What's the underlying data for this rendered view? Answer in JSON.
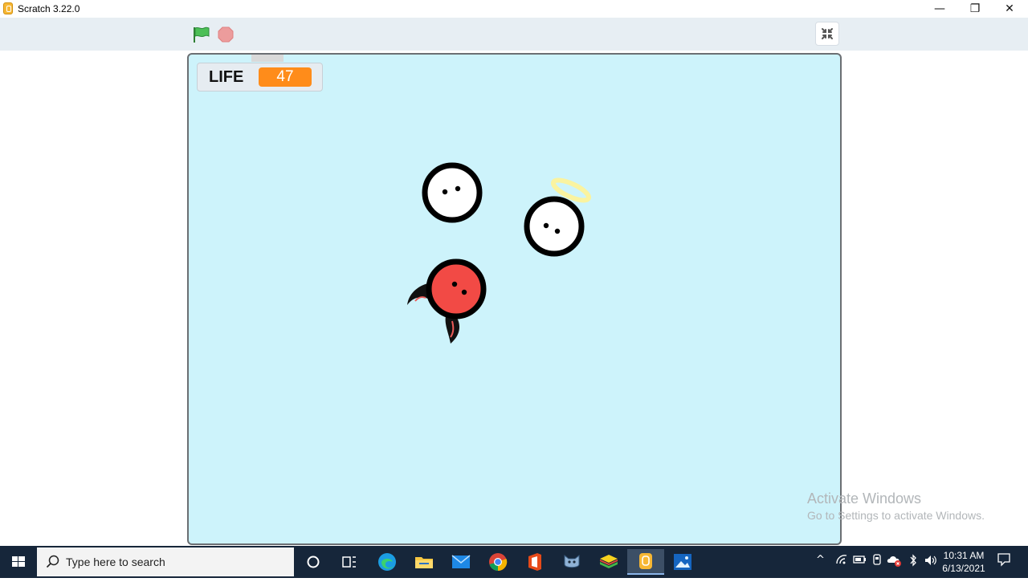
{
  "window": {
    "title": "Scratch 3.22.0",
    "minimize_glyph": "—",
    "restore_glyph": "❐",
    "close_glyph": "✕"
  },
  "toolbar": {
    "green_flag_icon": "green-flag-icon",
    "stop_icon": "stop-sign-icon",
    "unfullscreen_icon": "exit-fullscreen-icon"
  },
  "stage": {
    "background_color": "#cdf3fb",
    "monitor": {
      "label": "LIFE",
      "value": "47"
    },
    "sprites": [
      "white-ball-character",
      "angel-ball-character",
      "devil-ball-character"
    ]
  },
  "watermark": {
    "title": "Activate Windows",
    "subtitle": "Go to Settings to activate Windows."
  },
  "taskbar": {
    "search_placeholder": "Type here to search",
    "apps": [
      "cortana-icon",
      "task-view-icon",
      "edge-icon",
      "file-explorer-icon",
      "mail-icon",
      "chrome-icon",
      "office-icon",
      "scratch-cat-icon",
      "bluestacks-icon",
      "scratch-app-icon",
      "photos-icon"
    ],
    "clock": {
      "time": "10:31 AM",
      "date": "6/13/2021"
    }
  }
}
